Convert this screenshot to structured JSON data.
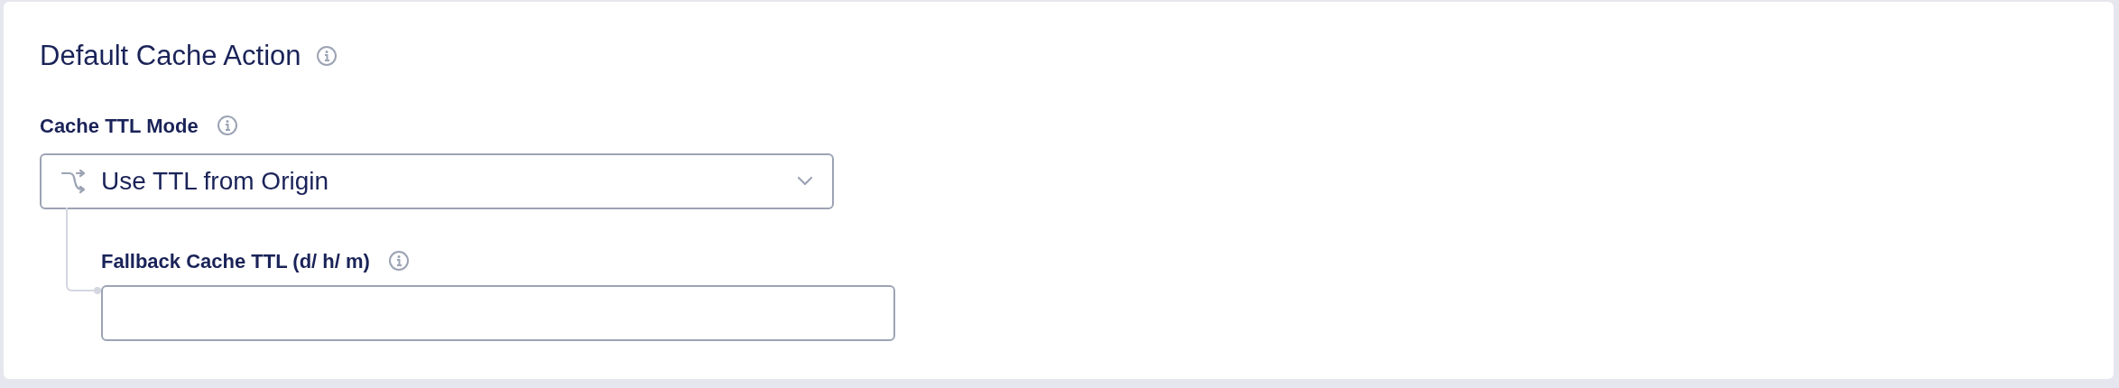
{
  "title": "Default Cache Action",
  "mode": {
    "label": "Cache TTL Mode",
    "value": "Use TTL from Origin"
  },
  "fallback": {
    "label": "Fallback Cache TTL (d/ h/ m)"
  }
}
